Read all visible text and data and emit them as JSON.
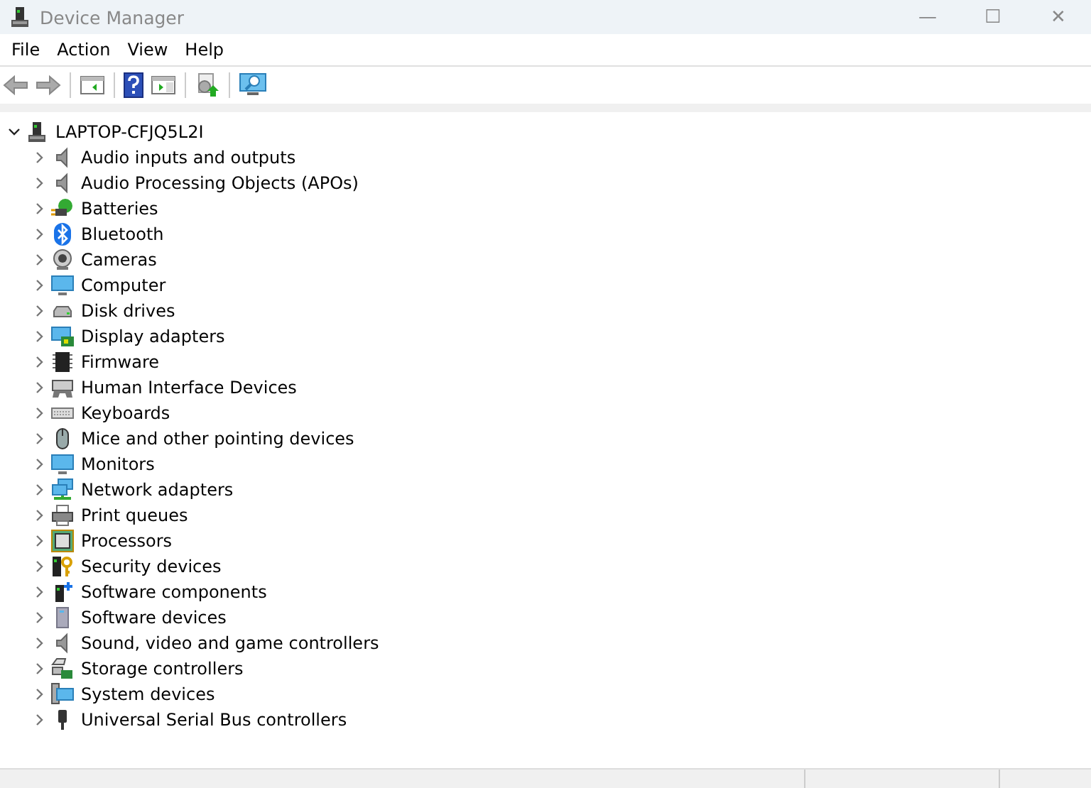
{
  "window": {
    "title": "Device Manager",
    "controls": [
      "—",
      "☐",
      "✕"
    ]
  },
  "menu": [
    "File",
    "Action",
    "View",
    "Help"
  ],
  "tree": {
    "root": {
      "label": "LAPTOP-CFJQ5L2I",
      "expanded": true,
      "children": [
        {
          "label": "Audio inputs and outputs",
          "expanded": false
        },
        {
          "label": "Audio Processing Objects (APOs)",
          "expanded": false
        },
        {
          "label": "Batteries",
          "expanded": false
        },
        {
          "label": "Bluetooth",
          "expanded": false
        },
        {
          "label": "Cameras",
          "expanded": false
        },
        {
          "label": "Computer",
          "expanded": false
        },
        {
          "label": "Disk drives",
          "expanded": false
        },
        {
          "label": "Display adapters",
          "expanded": false
        },
        {
          "label": "Firmware",
          "expanded": false
        },
        {
          "label": "Human Interface Devices",
          "expanded": false
        },
        {
          "label": "Keyboards",
          "expanded": false
        },
        {
          "label": "Mice and other pointing devices",
          "expanded": false
        },
        {
          "label": "Monitors",
          "expanded": false
        },
        {
          "label": "Network adapters",
          "expanded": false
        },
        {
          "label": "Print queues",
          "expanded": false
        },
        {
          "label": "Processors",
          "expanded": false
        },
        {
          "label": "Security devices",
          "expanded": false
        },
        {
          "label": "Software components",
          "expanded": false
        },
        {
          "label": "Software devices",
          "expanded": false
        },
        {
          "label": "Sound, video and game controllers",
          "expanded": false
        },
        {
          "label": "Storage controllers",
          "expanded": false
        },
        {
          "label": "System devices",
          "expanded": false
        },
        {
          "label": "Universal Serial Bus controllers",
          "expanded": false
        }
      ]
    }
  }
}
